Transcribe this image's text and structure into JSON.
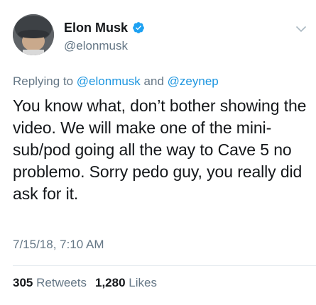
{
  "author": {
    "display_name": "Elon Musk",
    "handle": "@elonmusk",
    "verified": true,
    "verified_color": "#1da1f2"
  },
  "reply": {
    "prefix": "Replying to",
    "mention_1": "@elonmusk",
    "joiner": "and",
    "mention_2": "@zeynep"
  },
  "tweet": {
    "text": "You know what, don’t bother showing the video. We will make one of the mini-sub/pod going all the way to Cave 5 no problemo. Sorry pedo guy, you really did ask for it.",
    "timestamp": "7/15/18, 7:10 AM"
  },
  "stats": {
    "retweets_count": "305",
    "retweets_label": "Retweets",
    "likes_count": "1,280",
    "likes_label": "Likes"
  },
  "colors": {
    "text_primary": "#14171a",
    "text_secondary": "#657786",
    "link": "#1b95e0",
    "divider": "#e6ecf0"
  },
  "icons": {
    "verified": "verified-badge-icon",
    "menu": "chevron-down-icon"
  }
}
